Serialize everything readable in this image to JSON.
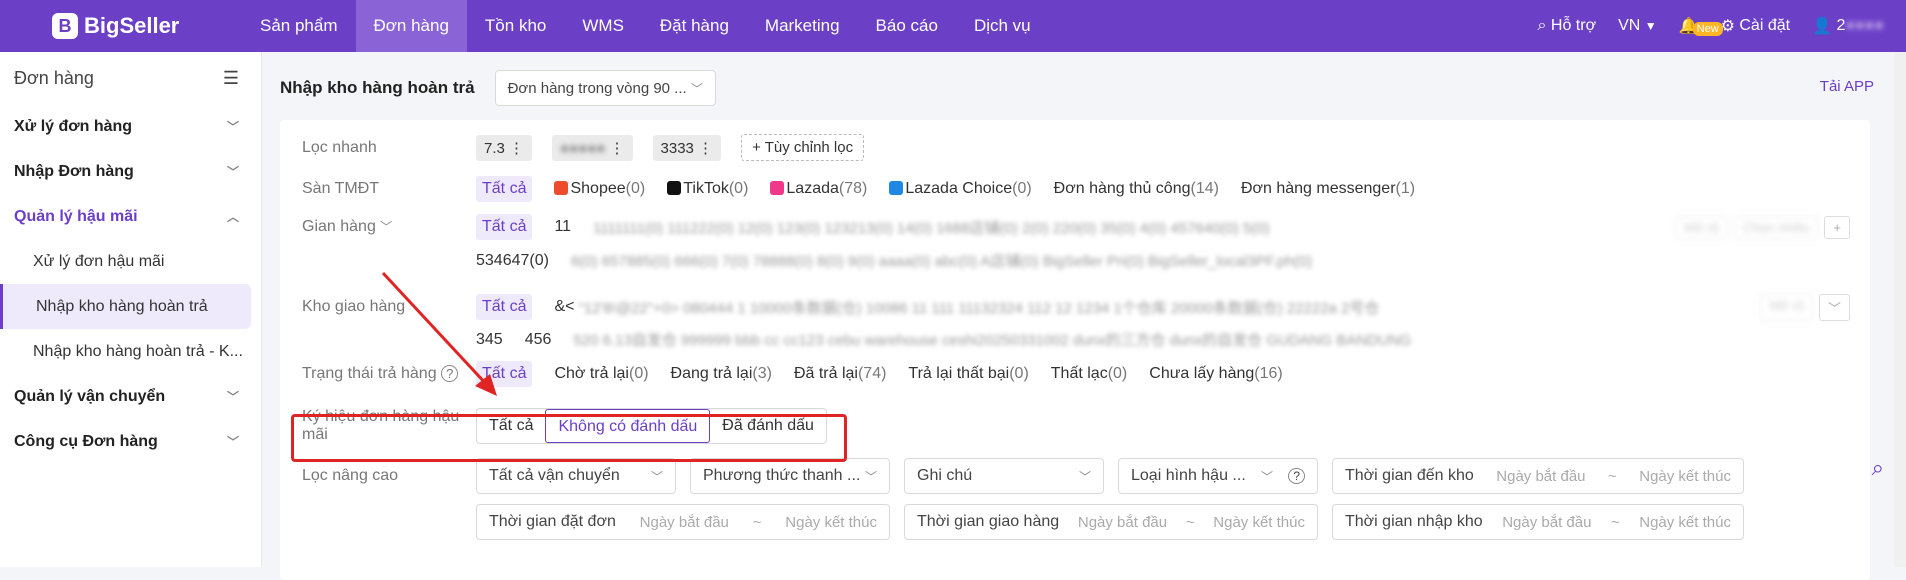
{
  "topbar": {
    "logo": "BigSeller",
    "nav": [
      "Sản phẩm",
      "Đơn hàng",
      "Tồn kho",
      "WMS",
      "Đặt hàng",
      "Marketing",
      "Báo cáo",
      "Dịch vụ"
    ],
    "help": "Hỗ trợ",
    "lang": "VN",
    "new_badge": "New",
    "settings": "Cài đặt",
    "user": "2"
  },
  "sidebar": {
    "title": "Đơn hàng",
    "groups": [
      "Xử lý đơn hàng",
      "Nhập Đơn hàng",
      "Quản lý hậu mãi",
      "Quản lý vận chuyển",
      "Công cụ Đơn hàng"
    ],
    "subs": [
      "Xử lý đơn hậu mãi",
      "Nhập kho hàng hoàn trả",
      "Nhập kho hàng hoàn trả - K..."
    ]
  },
  "page": {
    "title": "Nhập kho hàng hoàn trả",
    "range_select": "Đơn hàng trong vòng 90 ...",
    "tai_app": "Tải APP"
  },
  "filters": {
    "quick": {
      "label": "Lọc nhanh",
      "chips": [
        "7.3",
        "3333"
      ],
      "custom": "+ Tùy chỉnh lọc"
    },
    "platform": {
      "label": "Sàn TMĐT",
      "all": "Tất cả",
      "items": [
        {
          "name": "Shopee",
          "count": "(0)"
        },
        {
          "name": "TikTok",
          "count": "(0)"
        },
        {
          "name": "Lazada",
          "count": "(78)"
        },
        {
          "name": "Lazada Choice",
          "count": "(0)"
        },
        {
          "name": "Đơn hàng thủ công",
          "count": "(14)"
        },
        {
          "name": "Đơn hàng messenger",
          "count": "(1)"
        }
      ]
    },
    "shop": {
      "label": "Gian hàng",
      "all": "Tất cả",
      "first": "11",
      "second_row": "534647(0)"
    },
    "warehouse": {
      "label": "Kho giao hàng",
      "all": "Tất cả",
      "first": "&<",
      "extra": [
        "345",
        "456"
      ]
    },
    "return_status": {
      "label": "Trạng thái trả hàng",
      "all": "Tất cả",
      "items": [
        {
          "name": "Chờ trả lại",
          "count": "(0)"
        },
        {
          "name": "Đang trả lại",
          "count": "(3)"
        },
        {
          "name": "Đã trả lại",
          "count": "(74)"
        },
        {
          "name": "Trả lại thất bại",
          "count": "(0)"
        },
        {
          "name": "Thất lạc",
          "count": "(0)"
        },
        {
          "name": "Chưa lấy hàng",
          "count": "(16)"
        }
      ]
    },
    "mark": {
      "label": "Ký hiệu đơn hàng hậu mãi",
      "options": [
        "Tất cả",
        "Không có đánh dấu",
        "Đã đánh dấu"
      ]
    },
    "advanced": {
      "label": "Lọc nâng cao",
      "shipping": "Tất cả vận chuyển",
      "method": "Phương thức thanh ...",
      "note": "Ghi chú",
      "type": "Loại hình hậu ...",
      "arrive": "Thời gian đến kho",
      "order_time": "Thời gian đặt đơn",
      "ship_time": "Thời gian giao hàng",
      "import_time": "Thời gian nhập kho",
      "start": "Ngày bắt đầu",
      "end": "Ngày kết thúc",
      "tilde": "~"
    }
  }
}
